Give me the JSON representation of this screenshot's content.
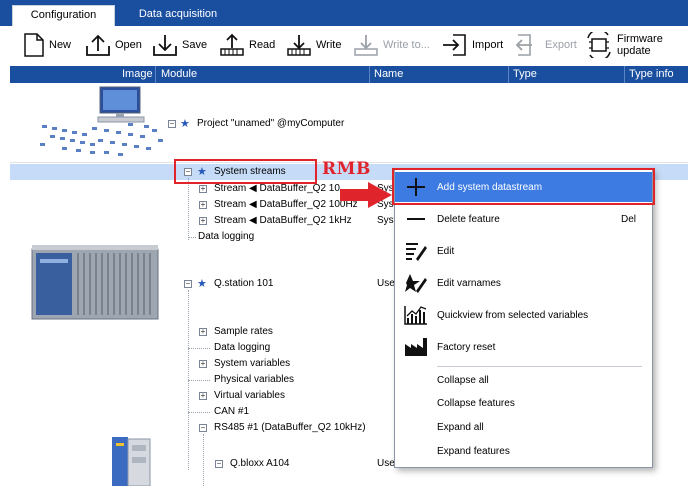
{
  "tabs": [
    {
      "label": "Configuration",
      "active": true
    },
    {
      "label": "Data acquisition",
      "active": false
    }
  ],
  "toolbar": {
    "new": "New",
    "open": "Open",
    "save": "Save",
    "read": "Read",
    "write": "Write",
    "write_to": "Write to...",
    "import": "Import",
    "export": "Export",
    "firmware_update": "Firmware update"
  },
  "columns": {
    "image": "Image",
    "module": "Module",
    "name": "Name",
    "type": "Type",
    "type_info": "Type info"
  },
  "tree": {
    "project": "Project \"unamed\" @myComputer",
    "system_streams": "System streams",
    "stream_1": "Stream ◀ DataBuffer_Q2 10",
    "stream_2": "Stream ◀ DataBuffer_Q2 100Hz",
    "stream_3": "Stream ◀ DataBuffer_Q2 1kHz",
    "stream_1_name": "Syst",
    "stream_2_name": "Sys",
    "stream_3_name": "Syst",
    "data_logging_top": "Data logging",
    "qstation": "Q.station 101",
    "qstation_name": "User",
    "sample_rates": "Sample rates",
    "data_logging": "Data logging",
    "system_variables": "System variables",
    "physical_variables": "Physical variables",
    "virtual_variables": "Virtual variables",
    "can": "CAN #1",
    "rs485": "RS485 #1 (DataBuffer_Q2 10kHz)",
    "qbloxx": "Q.bloxx A104",
    "qbloxx_name": "User"
  },
  "context_menu": {
    "items": [
      {
        "label": "Add system datastream",
        "shortcut": "",
        "icon": "plus-icon",
        "highlighted": true
      },
      {
        "label": "Delete feature",
        "shortcut": "Del",
        "icon": "minus-icon"
      },
      {
        "label": "Edit",
        "shortcut": "",
        "icon": "edit-list-icon"
      },
      {
        "label": "Edit varnames",
        "shortcut": "",
        "icon": "edit-varnames-icon"
      },
      {
        "label": "Quickview from selected variables",
        "shortcut": "",
        "icon": "chart-icon"
      },
      {
        "label": "Factory reset",
        "shortcut": "",
        "icon": "factory-icon"
      },
      {
        "label": "Collapse all",
        "shortcut": ""
      },
      {
        "label": "Collapse features",
        "shortcut": ""
      },
      {
        "label": "Expand all",
        "shortcut": ""
      },
      {
        "label": "Expand features",
        "shortcut": ""
      }
    ]
  },
  "annotation": {
    "rmb": "RMB"
  },
  "colors": {
    "header_blue": "#1a4fa0",
    "selection": "#c6dbf7",
    "menu_highlight": "#3d7be3",
    "annotation_red": "#e0242c"
  }
}
